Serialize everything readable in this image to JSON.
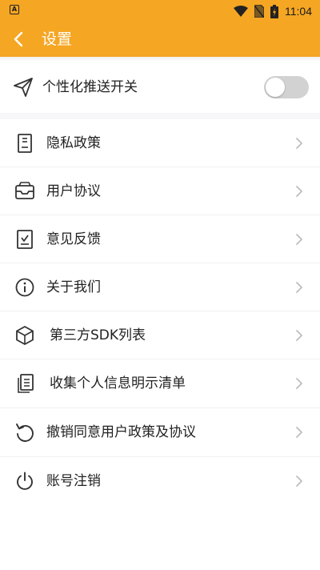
{
  "status_bar": {
    "app_badge": "A",
    "time": "11:04"
  },
  "app_bar": {
    "title": "设置"
  },
  "push_setting": {
    "label": "个性化推送开关",
    "enabled": false
  },
  "menu": {
    "items": [
      {
        "label": "隐私政策",
        "icon": "document-icon"
      },
      {
        "label": "用户协议",
        "icon": "inbox-icon"
      },
      {
        "label": "意见反馈",
        "icon": "feedback-icon"
      },
      {
        "label": "关于我们",
        "icon": "info-icon"
      },
      {
        "label": "第三方SDK列表",
        "icon": "cube-icon"
      },
      {
        "label": "收集个人信息明示清单",
        "icon": "copy-list-icon"
      },
      {
        "label": "撤销同意用户政策及协议",
        "icon": "undo-icon"
      },
      {
        "label": "账号注销",
        "icon": "power-icon"
      }
    ]
  },
  "colors": {
    "accent": "#F5A623",
    "toggle_off": "#D2D2D2",
    "chevron": "#BDBDBD"
  }
}
